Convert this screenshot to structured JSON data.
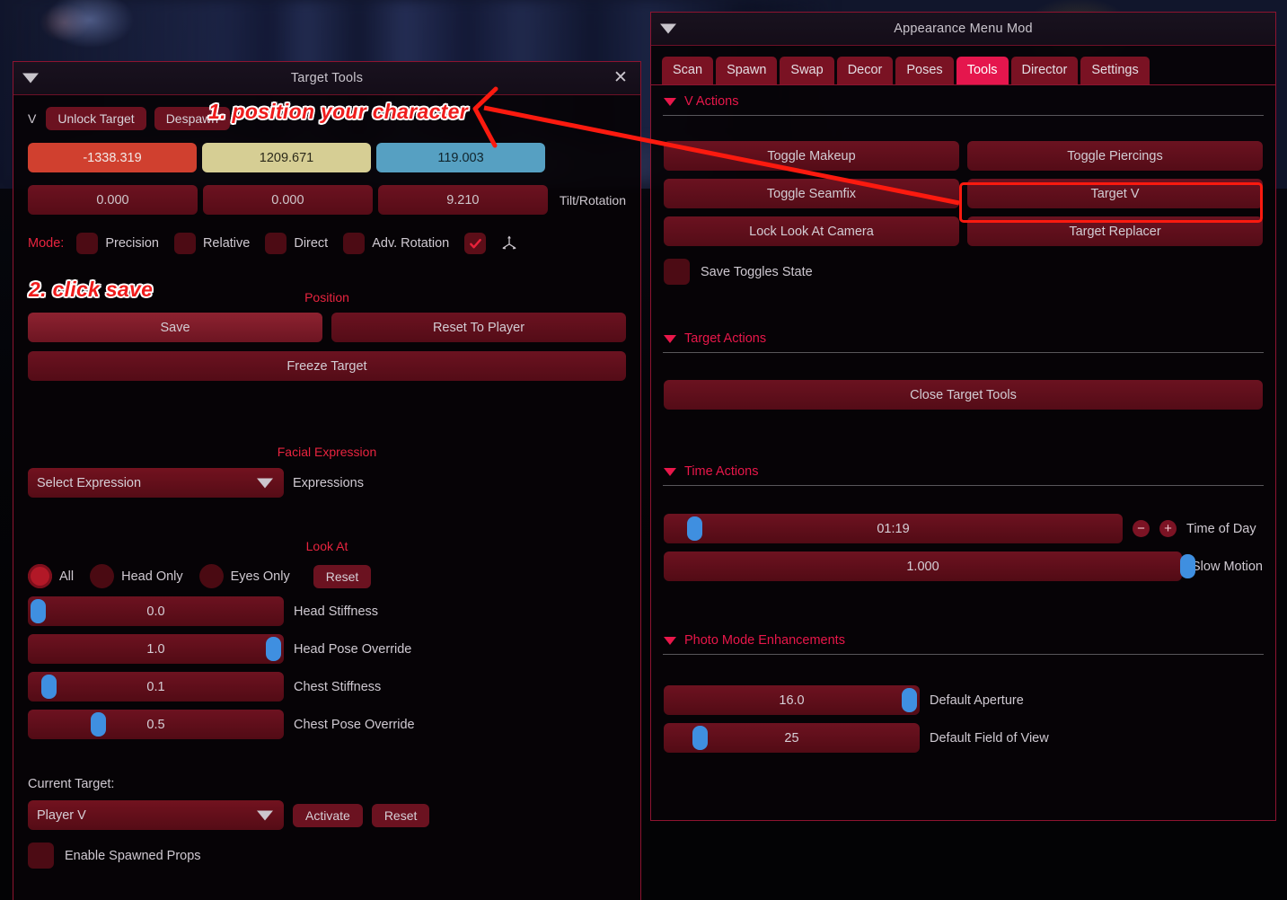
{
  "left_panel": {
    "title": "Target Tools",
    "collapse_icon": "caret-down-icon",
    "close_icon": "close-icon",
    "v_letter": "V",
    "unlock_target": "Unlock Target",
    "despawn": "Despawn",
    "coords": [
      {
        "value": "-1338.319",
        "axis": "x",
        "color": "#d0402f"
      },
      {
        "value": "1209.671",
        "axis": "y",
        "color": "#d6ce94"
      },
      {
        "value": "119.003",
        "axis": "z",
        "color": "#56a0c2"
      }
    ],
    "rotation": [
      {
        "value": "0.000"
      },
      {
        "value": "0.000"
      },
      {
        "value": "9.210"
      }
    ],
    "tilt_label": "Tilt/Rotation",
    "mode_label": "Mode:",
    "modes": [
      {
        "label": "Precision",
        "checked": false
      },
      {
        "label": "Relative",
        "checked": false
      },
      {
        "label": "Direct",
        "checked": false
      },
      {
        "label": "Adv. Rotation",
        "checked": false
      }
    ],
    "gizmo_checkbox_checked": true,
    "position_section": "Position",
    "save_label": "Save",
    "reset_to_player_label": "Reset To Player",
    "freeze_target_label": "Freeze Target",
    "facial_expression_section": "Facial Expression",
    "expression_select_value": "Select Expression",
    "expressions_label": "Expressions",
    "look_at_section": "Look At",
    "look_at_options": [
      {
        "label": "All",
        "selected": true
      },
      {
        "label": "Head Only",
        "selected": false
      },
      {
        "label": "Eyes Only",
        "selected": false
      }
    ],
    "look_at_reset": "Reset",
    "sliders": [
      {
        "label": "Head Stiffness",
        "value": "0.0",
        "fill_pct": 0
      },
      {
        "label": "Head Pose Override",
        "value": "1.0",
        "fill_pct": 100
      },
      {
        "label": "Chest Stiffness",
        "value": "0.1",
        "fill_pct": 8
      },
      {
        "label": "Chest Pose Override",
        "value": "0.5",
        "fill_pct": 27
      }
    ],
    "current_target_label": "Current Target:",
    "current_target_value": "Player V",
    "activate_label": "Activate",
    "target_reset_label": "Reset",
    "enable_spawned_props_label": "Enable Spawned Props",
    "enable_spawned_props_checked": false
  },
  "right_panel": {
    "title": "Appearance Menu Mod",
    "collapse_icon": "caret-down-icon",
    "tabs": [
      {
        "label": "Scan",
        "active": false
      },
      {
        "label": "Spawn",
        "active": false
      },
      {
        "label": "Swap",
        "active": false
      },
      {
        "label": "Decor",
        "active": false
      },
      {
        "label": "Poses",
        "active": false
      },
      {
        "label": "Tools",
        "active": true
      },
      {
        "label": "Director",
        "active": false
      },
      {
        "label": "Settings",
        "active": false
      }
    ],
    "sections": {
      "v_actions": {
        "title": "V Actions",
        "buttons": [
          "Toggle Makeup",
          "Toggle Piercings",
          "Toggle Seamfix",
          "Target V",
          "Lock Look At Camera",
          "Target Replacer"
        ],
        "highlighted_button": "Target V",
        "save_toggles_label": "Save Toggles State",
        "save_toggles_checked": false
      },
      "target_actions": {
        "title": "Target Actions",
        "close_target_tools": "Close Target Tools"
      },
      "time_actions": {
        "title": "Time Actions",
        "sliders": [
          {
            "label": "Time of Day",
            "value": "01:19",
            "fill_pct": 3,
            "has_steppers": true,
            "minus_icon": "minus-circle-icon",
            "plus_icon": "plus-circle-icon"
          },
          {
            "label": "Slow Motion",
            "value": "1.000",
            "fill_pct": 100,
            "has_steppers": false
          }
        ]
      },
      "photo_mode": {
        "title": "Photo Mode Enhancements",
        "sliders": [
          {
            "label": "Default Aperture",
            "value": "16.0",
            "fill_pct": 100
          },
          {
            "label": "Default Field of View",
            "value": "25",
            "fill_pct": 11
          }
        ]
      }
    }
  },
  "annotations": [
    {
      "id": "step1",
      "text": "1. position your character",
      "color": "#ef1c1c"
    },
    {
      "id": "step2",
      "text": "2. click save",
      "color": "#ef1c1c"
    }
  ],
  "colors": {
    "accent_pink": "#e8174a",
    "panel_border": "#8d1430",
    "button_red": "#6b1220",
    "slider_grab_blue": "#3f8fe0",
    "annotation_red": "#ef1c1c",
    "active_tab": "#e5164d"
  }
}
